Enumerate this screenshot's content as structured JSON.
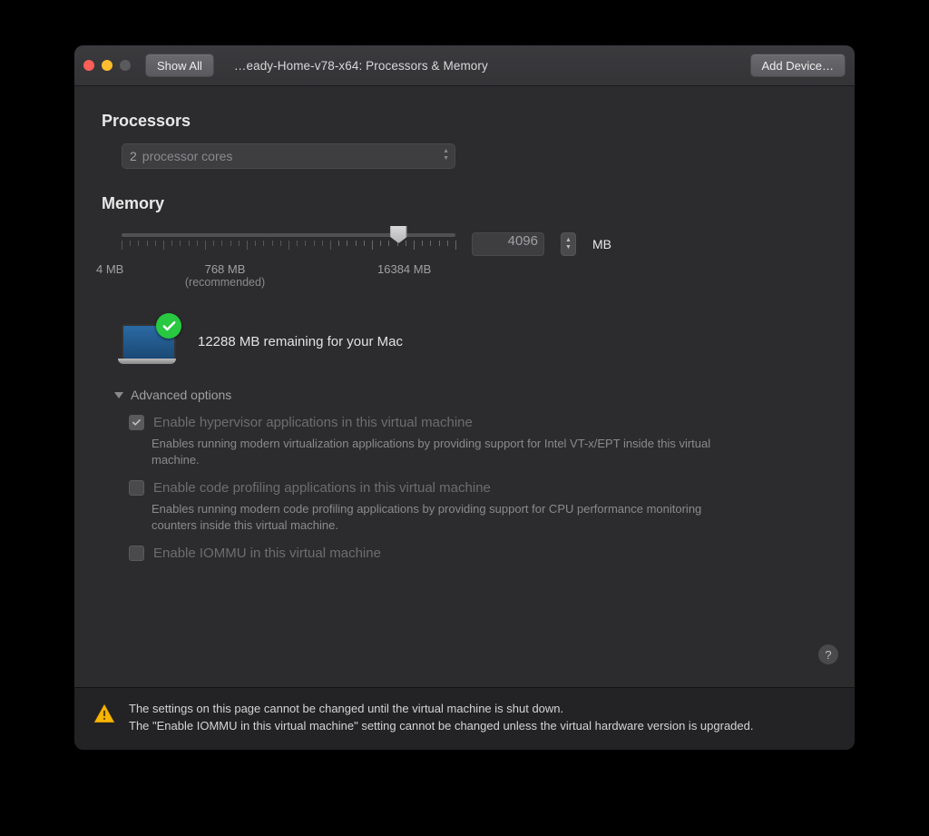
{
  "window": {
    "show_all_label": "Show All",
    "title": "…eady-Home-v78-x64: Processors & Memory",
    "add_device_label": "Add Device…"
  },
  "processors": {
    "heading": "Processors",
    "core_count": "2",
    "core_label": "processor cores"
  },
  "memory": {
    "heading": "Memory",
    "value": "4096",
    "unit": "MB",
    "min_label": "4 MB",
    "recommended_label": "768 MB",
    "recommended_sub": "(recommended)",
    "max_label": "16384 MB",
    "remaining_text": "12288 MB remaining for your Mac"
  },
  "advanced": {
    "toggle_label": "Advanced options",
    "options": [
      {
        "label": "Enable hypervisor applications in this virtual machine",
        "desc": "Enables running modern virtualization applications by providing support for Intel VT-x/EPT inside this virtual machine.",
        "checked": true
      },
      {
        "label": "Enable code profiling applications in this virtual machine",
        "desc": "Enables running modern code profiling applications by providing support for CPU performance monitoring counters inside this virtual machine.",
        "checked": false
      },
      {
        "label": "Enable IOMMU in this virtual machine",
        "desc": "",
        "checked": false
      }
    ]
  },
  "help_label": "?",
  "footer": {
    "line1": "The settings on this page cannot be changed until the virtual machine is shut down.",
    "line2": "The \"Enable IOMMU in this virtual machine\" setting cannot be changed unless the virtual hardware version is upgraded."
  }
}
